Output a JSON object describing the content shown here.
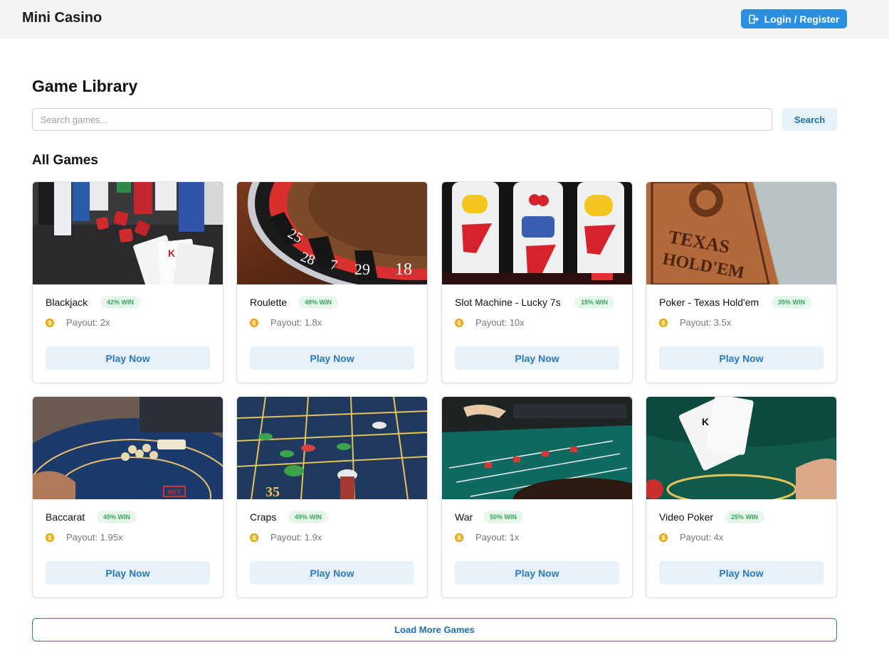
{
  "header": {
    "brand": "Mini Casino",
    "login_label": "Login / Register",
    "login_icon": "login-icon"
  },
  "main": {
    "title": "Game Library",
    "search": {
      "placeholder": "Search games...",
      "value": "",
      "button_label": "Search"
    },
    "section_title": "All Games",
    "load_more_label": "Load More Games"
  },
  "games": [
    {
      "name": "Blackjack",
      "win": "42% WIN",
      "payout": "Payout: 2x",
      "play_label": "Play Now",
      "image": "blackjack-photo"
    },
    {
      "name": "Roulette",
      "win": "48% WIN",
      "payout": "Payout: 1.8x",
      "play_label": "Play Now",
      "image": "roulette-photo"
    },
    {
      "name": "Slot Machine - Lucky 7s",
      "win": "15% WIN",
      "payout": "Payout: 10x",
      "play_label": "Play Now",
      "image": "slot-machine-photo"
    },
    {
      "name": "Poker - Texas Hold'em",
      "win": "35% WIN",
      "payout": "Payout: 3.5x",
      "play_label": "Play Now",
      "image": "poker-photo"
    },
    {
      "name": "Baccarat",
      "win": "45% WIN",
      "payout": "Payout: 1.95x",
      "play_label": "Play Now",
      "image": "baccarat-photo"
    },
    {
      "name": "Craps",
      "win": "49% WIN",
      "payout": "Payout: 1.9x",
      "play_label": "Play Now",
      "image": "craps-photo"
    },
    {
      "name": "War",
      "win": "50% WIN",
      "payout": "Payout: 1x",
      "play_label": "Play Now",
      "image": "war-photo"
    },
    {
      "name": "Video Poker",
      "win": "25% WIN",
      "payout": "Payout: 4x",
      "play_label": "Play Now",
      "image": "video-poker-photo"
    }
  ],
  "image_text": {
    "roulette_numbers": [
      "25",
      "28",
      "7",
      "29",
      "18"
    ],
    "poker_card_line1": "TEXAS",
    "poker_card_line2": "HOLD'EM",
    "craps_number": "35",
    "baccarat_label": "BET",
    "coin_symbol": "$"
  },
  "colors": {
    "accent": "#2b8fe0",
    "win_badge_bg": "#e8f7ec",
    "win_badge_text": "#35a55a",
    "play_button_bg": "#e6f1fa",
    "play_button_text": "#2b79c2",
    "coin": "#f2b51c"
  }
}
